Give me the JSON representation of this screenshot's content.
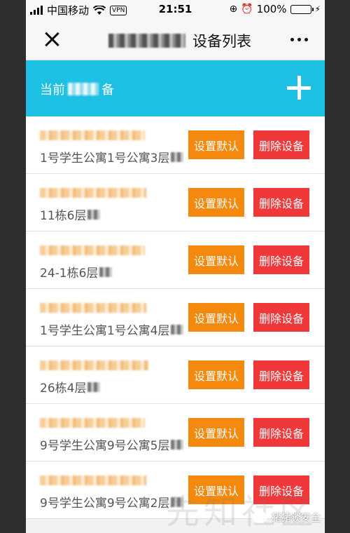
{
  "status_bar": {
    "carrier": "中国移动",
    "vpn": "VPN",
    "time": "21:51",
    "battery": "100%",
    "battery_level": 1.0
  },
  "nav": {
    "title": "设备列表",
    "close_icon": "close-icon",
    "more_icon": "more-dots-icon"
  },
  "banner": {
    "label_prefix": "当前",
    "label_suffix": "备",
    "add_icon": "plus-icon"
  },
  "devices": [
    {
      "location": "1号学生公寓1号公寓3层",
      "default_label": "设置默认",
      "delete_label": "删除设备"
    },
    {
      "location": "11栋6层",
      "default_label": "设置默认",
      "delete_label": "删除设备"
    },
    {
      "location": "24-1栋6层",
      "default_label": "设置默认",
      "delete_label": "删除设备"
    },
    {
      "location": "1号学生公寓1号公寓4层",
      "default_label": "设置默认",
      "delete_label": "删除设备"
    },
    {
      "location": "26栋4层",
      "default_label": "设置默认",
      "delete_label": "删除设备"
    },
    {
      "location": "9号学生公寓9号公寓5层",
      "default_label": "设置默认",
      "delete_label": "删除设备"
    },
    {
      "location": "9号学生公寓9号公寓2层",
      "default_label": "设置默认",
      "delete_label": "删除设备"
    }
  ],
  "colors": {
    "banner": "#1ec0e4",
    "default_button": "#f5890d",
    "delete_button": "#f0383b"
  },
  "watermark": {
    "text": "猪猪谈安全",
    "site_text": "先知社区"
  }
}
